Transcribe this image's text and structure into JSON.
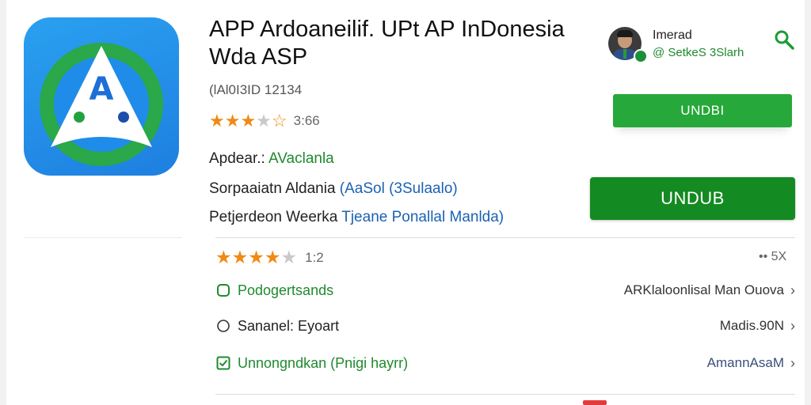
{
  "app": {
    "title_line1": "APP Ardoaneilif. UPt AP InDonesia",
    "title_line2": "Wda ASP",
    "app_id": "(lAl0I3ID 12134",
    "icon_letter": "A",
    "rating_value": "3:66",
    "star_rating_fraction": 0.7
  },
  "details": {
    "developer_label": "Apdear.: ",
    "developer_value": "AVaclanla",
    "support_label": "Sorpaaiatn Aldania ",
    "support_value": "(AaSol (3Sulaalo)",
    "category_label": "Petjerdeon Weerka ",
    "category_value": "Tjeane Ponallal Manlda)"
  },
  "profile": {
    "name": "Imerad",
    "subtitle": "@ SetkeS 3Slarh"
  },
  "buttons": {
    "download_small": "UNDBI",
    "download_large": "UNDUB"
  },
  "reviews": {
    "rating_value": "1:2",
    "star_rating_fraction": 0.8,
    "more_label": "•• 5X"
  },
  "list": [
    {
      "label": "Podogertsands",
      "value": "ARKlaloonlisal Man Ouova",
      "icon": "shield-icon",
      "tone": "green"
    },
    {
      "label": "Sananel: Eyoart",
      "value": "Madis.90N",
      "icon": "circle-icon",
      "tone": "dark"
    },
    {
      "label": "Unnongndkan (Pnigi hayrr)",
      "value": "AmannAsaM",
      "icon": "checkbox-icon",
      "tone": "green"
    }
  ],
  "colors": {
    "brand_blue": "#1e7fe0",
    "brand_green": "#148a22",
    "button_green": "#27a83a",
    "star_orange": "#f08a14"
  }
}
